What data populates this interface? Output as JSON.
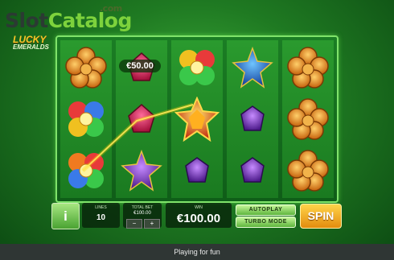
{
  "watermark": {
    "brand_a": "Slot",
    "brand_b": "Catalog",
    "tld": ".com"
  },
  "game_logo": {
    "line1": "LUCKY",
    "line2": "EMERALDS"
  },
  "reels": [
    [
      "clover-flower-orange",
      "rainbow-clover",
      "rainbow-clover"
    ],
    [
      "ruby-gem",
      "ruby-gem",
      "amethyst-star"
    ],
    [
      "rainbow-clover",
      "gold-star-gem",
      "amethyst-gem"
    ],
    [
      "sapphire-star",
      "amethyst-gem",
      "amethyst-gem"
    ],
    [
      "clover-flower-orange",
      "clover-flower-orange",
      "clover-flower-orange"
    ]
  ],
  "win_badge": "€50.00",
  "controls": {
    "info_label": "i",
    "lines_caption": "LINES",
    "lines_value": "10",
    "total_bet_caption": "TOTAL BET",
    "total_bet_value": "€100.00",
    "minus_label": "−",
    "plus_label": "+",
    "win_caption": "WIN",
    "win_value": "€100.00",
    "autoplay_label": "AUTOPLAY",
    "turbo_label": "TURBO MODE",
    "spin_label": "SPIN"
  },
  "footer": {
    "status": "Playing for fun"
  },
  "colors": {
    "accent_green": "#7fe36a",
    "spin_orange": "#e38c0e",
    "footer_bg": "#2f3634"
  }
}
